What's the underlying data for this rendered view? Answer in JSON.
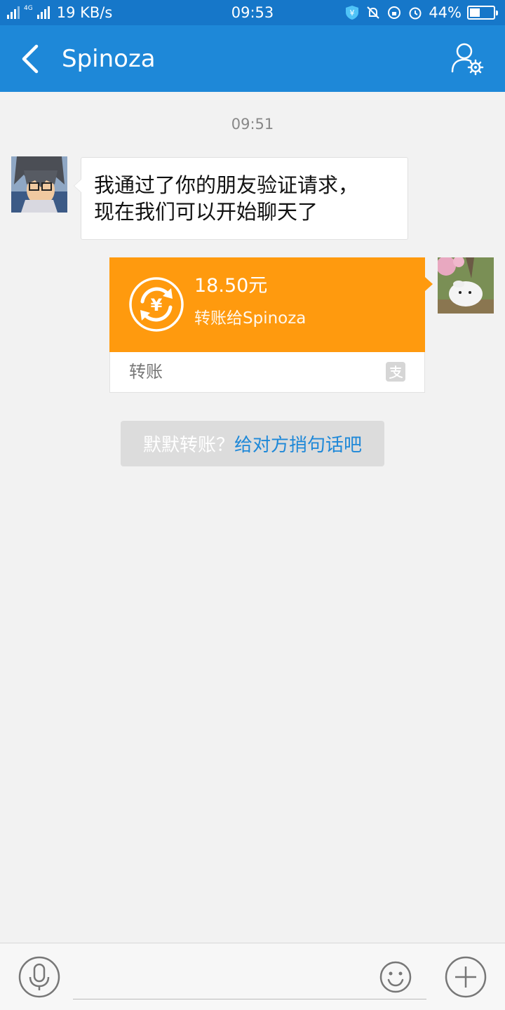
{
  "status_bar": {
    "network_speed": "19 KB/s",
    "network_type": "4G",
    "time": "09:53",
    "battery_percent": "44%",
    "battery_level": 0.44
  },
  "header": {
    "title": "Spinoza",
    "back_icon": "chevron-left-icon",
    "profile_icon": "user-settings-icon"
  },
  "chat": {
    "timestamp": "09:51",
    "incoming_message": {
      "line1": "我通过了你的朋友验证请求，",
      "line2": "现在我们可以开始聊天了"
    },
    "transfer": {
      "amount": "18.50元",
      "description": "转账给Spinoza",
      "label": "转账",
      "icon": "yuan-transfer-icon",
      "brand_icon": "alipay-icon",
      "color": "#ff9a0e"
    },
    "hint": {
      "prefix": "默默转账？",
      "link": "给对方捎句话吧"
    }
  },
  "input_bar": {
    "placeholder": "",
    "mic_icon": "microphone-icon",
    "emoji_icon": "emoji-icon",
    "plus_icon": "plus-icon"
  },
  "colors": {
    "header": "#1e88d8",
    "status_bar": "#1677c9",
    "background": "#f2f2f2",
    "link": "#1e88d8"
  }
}
